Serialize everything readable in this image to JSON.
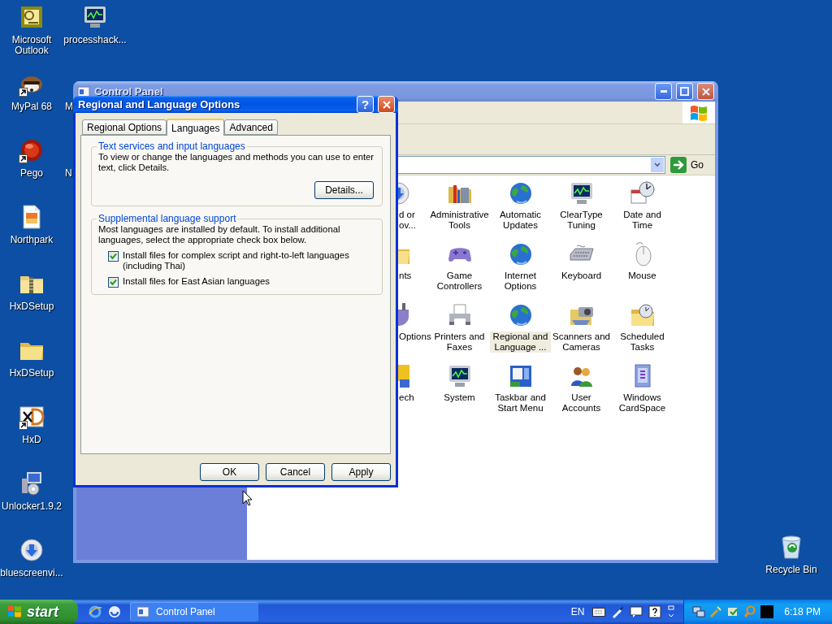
{
  "desktop": {
    "column_1": [
      {
        "label": "Microsoft Outlook",
        "kind": "tile",
        "shortcut": false
      },
      {
        "label": "MyPal 68",
        "kind": "animal",
        "shortcut": true
      },
      {
        "label": "Pego",
        "kind": "ball",
        "shortcut": true
      },
      {
        "label": "Northpark",
        "kind": "document",
        "shortcut": false
      },
      {
        "label": "HxDSetup",
        "kind": "zipfolder",
        "shortcut": false
      },
      {
        "label": "HxDSetup",
        "kind": "folder",
        "shortcut": false
      },
      {
        "label": "HxD",
        "kind": "hexapp",
        "shortcut": true
      },
      {
        "label": "Unlocker1.9.2",
        "kind": "installer",
        "shortcut": false
      },
      {
        "label": "bluescreenvi...",
        "kind": "disc",
        "shortcut": false
      }
    ],
    "column_2": [
      {
        "label": "processhack...",
        "kind": "monitor",
        "covered": false
      },
      {
        "label": "M",
        "covered": true
      },
      {
        "label": "N",
        "covered": true
      }
    ],
    "recycle_bin": {
      "label": "Recycle Bin",
      "kind": "bin"
    }
  },
  "control_panel": {
    "title": "Control Panel",
    "go": "Go",
    "items": [
      {
        "label": "d or\nov...",
        "kind": "disc",
        "covered": true,
        "selected": false
      },
      {
        "label": "Administrative Tools",
        "kind": "tools",
        "covered": false,
        "selected": false
      },
      {
        "label": "Automatic Updates",
        "kind": "globe",
        "covered": false,
        "selected": false
      },
      {
        "label": "ClearType Tuning",
        "kind": "monitor",
        "covered": false,
        "selected": false
      },
      {
        "label": "Date and Time",
        "kind": "clock",
        "covered": false,
        "selected": false
      },
      {
        "label": "nts",
        "kind": "folder",
        "covered": true,
        "selected": false
      },
      {
        "label": "Game Controllers",
        "kind": "gamepad",
        "covered": false,
        "selected": false
      },
      {
        "label": "Internet Options",
        "kind": "globe",
        "covered": false,
        "selected": false
      },
      {
        "label": "Keyboard",
        "kind": "keyboard",
        "covered": false,
        "selected": false
      },
      {
        "label": "Mouse",
        "kind": "mouse",
        "covered": false,
        "selected": false
      },
      {
        "label": "Options",
        "kind": "plug",
        "covered": true,
        "selected": false
      },
      {
        "label": "Printers and Faxes",
        "kind": "printer",
        "covered": false,
        "selected": false
      },
      {
        "label": "Regional and Language ...",
        "kind": "globe",
        "covered": false,
        "selected": true
      },
      {
        "label": "Scanners and Cameras",
        "kind": "camera",
        "covered": false,
        "selected": false
      },
      {
        "label": "Scheduled Tasks",
        "kind": "folderclock",
        "covered": false,
        "selected": false
      },
      {
        "label": "ech",
        "kind": "speech",
        "covered": true,
        "selected": false
      },
      {
        "label": "System",
        "kind": "monitor",
        "covered": false,
        "selected": false
      },
      {
        "label": "Taskbar and Start Menu",
        "kind": "window",
        "covered": false,
        "selected": false
      },
      {
        "label": "User Accounts",
        "kind": "people",
        "covered": false,
        "selected": false
      },
      {
        "label": "Windows CardSpace",
        "kind": "card",
        "covered": false,
        "selected": false
      }
    ]
  },
  "dialog": {
    "title": "Regional and Language Options",
    "help_button": "?",
    "tabs": [
      {
        "label": "Regional Options",
        "selected": false
      },
      {
        "label": "Languages",
        "selected": true
      },
      {
        "label": "Advanced",
        "selected": false
      }
    ],
    "groups": [
      {
        "title": "Text services and input languages",
        "text": "To view or change the languages and methods you can use to enter text, click Details.",
        "button": "Details..."
      },
      {
        "title": "Supplemental language support",
        "text": "Most languages are installed by default. To install additional languages, select the appropriate check box below.",
        "checkboxes": [
          {
            "label": "Install files for complex script and right-to-left languages (including Thai)",
            "checked": true
          },
          {
            "label": "Install files for East Asian languages",
            "checked": true
          }
        ]
      }
    ],
    "buttons": [
      "OK",
      "Cancel",
      "Apply"
    ]
  },
  "taskbar": {
    "start": "start",
    "tasks": [
      {
        "label": "Control Panel",
        "selected": false
      }
    ],
    "language": "EN",
    "clock": "6:18 PM"
  }
}
